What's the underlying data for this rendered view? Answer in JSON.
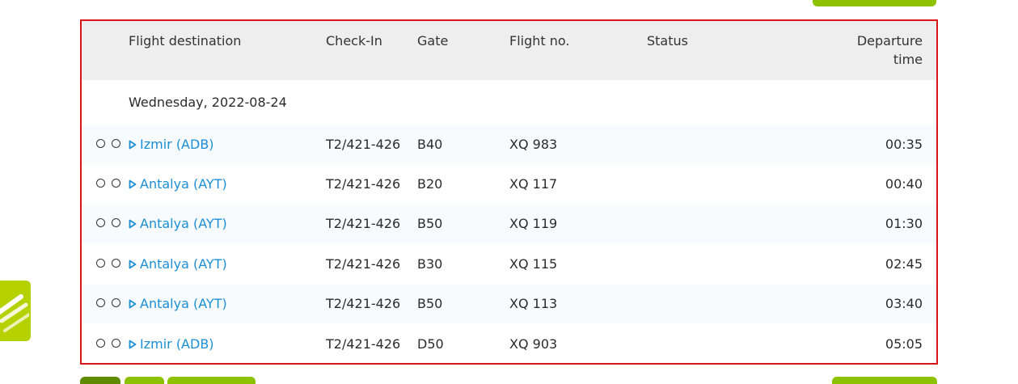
{
  "table": {
    "headers": {
      "destination": "Flight destination",
      "checkin": "Check-In",
      "gate": "Gate",
      "flight_no": "Flight no.",
      "status": "Status",
      "departure_line1": "Departure",
      "departure_line2": "time"
    },
    "date_label": "Wednesday, 2022-08-24",
    "rows": [
      {
        "destination": "Izmir (ADB)",
        "checkin": "T2/421-426",
        "gate": "B40",
        "flight_no": "XQ 983",
        "status": "",
        "time": "00:35"
      },
      {
        "destination": "Antalya (AYT)",
        "checkin": "T2/421-426",
        "gate": "B20",
        "flight_no": "XQ 117",
        "status": "",
        "time": "00:40"
      },
      {
        "destination": "Antalya (AYT)",
        "checkin": "T2/421-426",
        "gate": "B50",
        "flight_no": "XQ 119",
        "status": "",
        "time": "01:30"
      },
      {
        "destination": "Antalya (AYT)",
        "checkin": "T2/421-426",
        "gate": "B30",
        "flight_no": "XQ 115",
        "status": "",
        "time": "02:45"
      },
      {
        "destination": "Antalya (AYT)",
        "checkin": "T2/421-426",
        "gate": "B50",
        "flight_no": "XQ 113",
        "status": "",
        "time": "03:40"
      },
      {
        "destination": "Izmir (ADB)",
        "checkin": "T2/421-426",
        "gate": "D50",
        "flight_no": "XQ 903",
        "status": "",
        "time": "05:05"
      }
    ]
  },
  "colors": {
    "frame_border": "#d9141b",
    "link": "#1c8ed6",
    "accent_green": "#8dc200",
    "widget_green": "#b5d200",
    "header_bg": "#eeeeee"
  }
}
